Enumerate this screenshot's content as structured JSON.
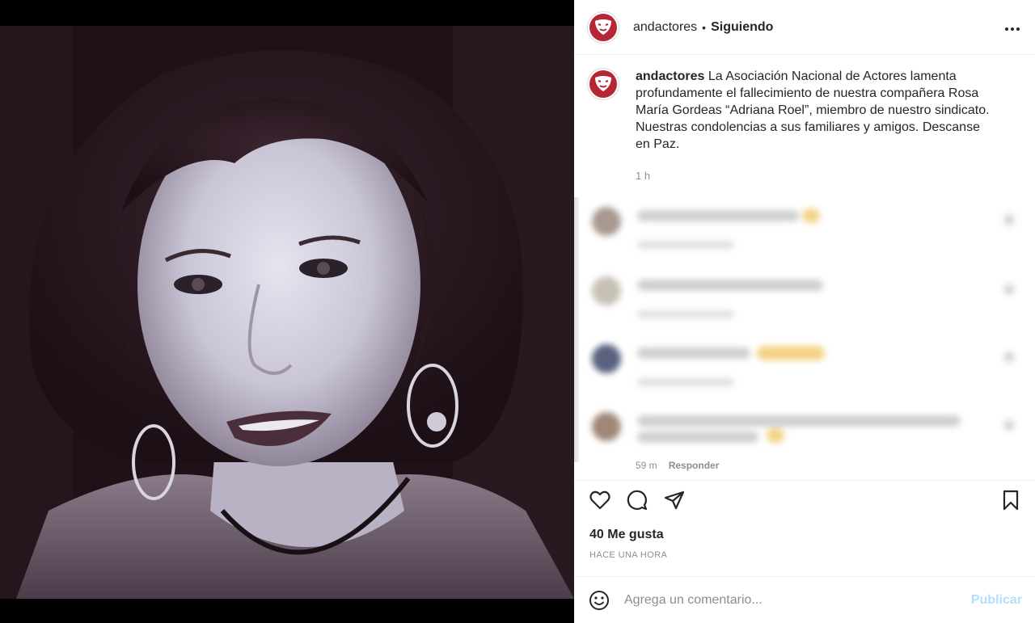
{
  "photo": {
    "alt_icon": "portrait-photo"
  },
  "header": {
    "username": "andactores",
    "dot": "•",
    "follow_label": "Siguiendo",
    "more_icon": "more-options-icon"
  },
  "caption": {
    "username": "andactores",
    "text": "La Asociación Nacional de Actores lamenta profundamente el fallecimiento de nuestra compañera Rosa María Gordeas “Adriana Roel”, miembro de nuestro sindicato. Nuestras condolencias a sus familiares y amigos. Descanse en Paz.",
    "time": "1 h"
  },
  "last_comment": {
    "time": "59 m",
    "reply_label": "Responder"
  },
  "actions": {
    "likes": "40 Me gusta",
    "ago": "HACE UNA HORA"
  },
  "comment_box": {
    "placeholder": "Agrega un comentario...",
    "publish_label": "Publicar"
  },
  "colors": {
    "brand_red": "#b52735",
    "publish_disabled": "#b2dffc",
    "text": "#262626",
    "muted": "#8e8e8e"
  }
}
